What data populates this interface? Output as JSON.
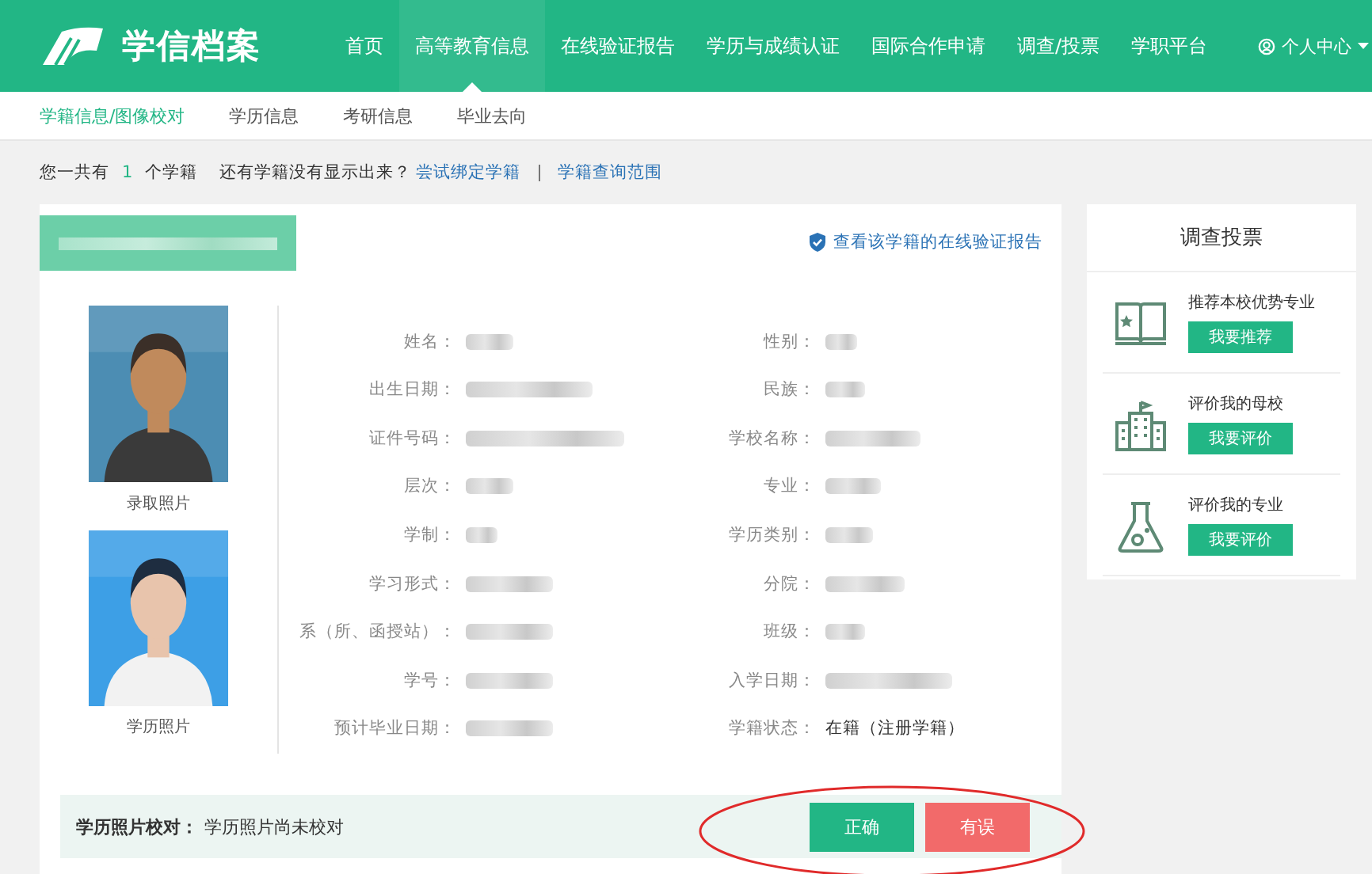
{
  "header": {
    "logo_text": "学信档案",
    "nav": [
      {
        "label": "首页",
        "selected": false
      },
      {
        "label": "高等教育信息",
        "selected": true
      },
      {
        "label": "在线验证报告",
        "selected": false
      },
      {
        "label": "学历与成绩认证",
        "selected": false
      },
      {
        "label": "国际合作申请",
        "selected": false
      },
      {
        "label": "调查/投票",
        "selected": false
      },
      {
        "label": "学职平台",
        "selected": false
      }
    ],
    "user_menu": "个人中心"
  },
  "subnav": [
    {
      "label": "学籍信息/图像校对",
      "selected": true
    },
    {
      "label": "学历信息",
      "selected": false
    },
    {
      "label": "考研信息",
      "selected": false
    },
    {
      "label": "毕业去向",
      "selected": false
    }
  ],
  "summary": {
    "prefix": "您一共有",
    "count": "1",
    "suffix": "个学籍",
    "question": "还有学籍没有显示出来？",
    "links": [
      "尝试绑定学籍",
      "学籍查询范围"
    ],
    "separator": "|"
  },
  "record": {
    "title_redacted": true,
    "report_link": "查看该学籍的在线验证报告",
    "photos": [
      {
        "kind": "picture",
        "caption": "录取照片"
      },
      {
        "kind": "picture",
        "caption": "学历照片"
      }
    ],
    "fields": [
      {
        "label": "姓名：",
        "redacted": true
      },
      {
        "label": "性别：",
        "redacted": true
      },
      {
        "label": "出生日期：",
        "redacted": true
      },
      {
        "label": "民族：",
        "redacted": true
      },
      {
        "label": "证件号码：",
        "redacted": true
      },
      {
        "label": "学校名称：",
        "redacted": true
      },
      {
        "label": "层次：",
        "redacted": true
      },
      {
        "label": "专业：",
        "redacted": true
      },
      {
        "label": "学制：",
        "redacted": true
      },
      {
        "label": "学历类别：",
        "redacted": true
      },
      {
        "label": "学习形式：",
        "redacted": true
      },
      {
        "label": "分院：",
        "redacted": true
      },
      {
        "label": "系（所、函授站）：",
        "redacted": true
      },
      {
        "label": "班级：",
        "redacted": true
      },
      {
        "label": "学号：",
        "redacted": true
      },
      {
        "label": "入学日期：",
        "redacted": true
      },
      {
        "label": "预计毕业日期：",
        "redacted": true
      },
      {
        "label": "学籍状态：",
        "redacted": false,
        "value": "在籍（注册学籍）"
      }
    ],
    "check": {
      "label": "学历照片校对：",
      "status": "学历照片尚未校对",
      "buttons": [
        {
          "label": "正确",
          "kind": "confirm"
        },
        {
          "label": "有误",
          "kind": "reject"
        }
      ],
      "annotation": {
        "kind": "ellipse",
        "color": "#e02a2a"
      }
    }
  },
  "survey": {
    "title": "调查投票",
    "items": [
      {
        "kind": "book",
        "text": "推荐本校优势专业",
        "action": "我要推荐"
      },
      {
        "kind": "school",
        "text": "评价我的母校",
        "action": "我要评价"
      },
      {
        "kind": "flask",
        "text": "评价我的专业",
        "action": "我要评价"
      }
    ]
  }
}
